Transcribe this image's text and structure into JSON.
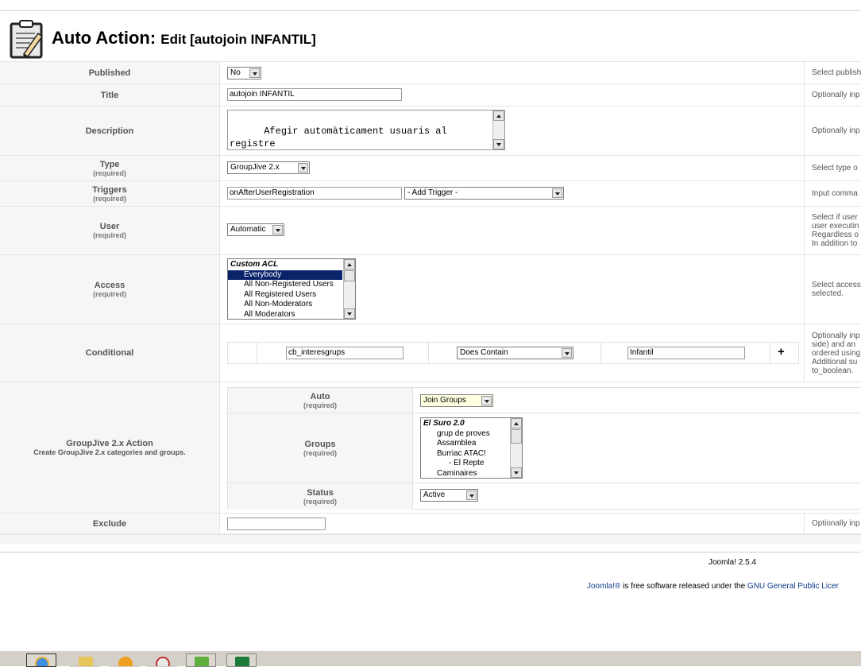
{
  "header": {
    "title_main": "Auto Action:",
    "title_sub": "Edit [autojoin INFANTIL]",
    "icon": "clipboard-pencil-icon"
  },
  "required_text": "(required)",
  "rows": {
    "published": {
      "label": "Published",
      "value": "No",
      "help": "Select publish"
    },
    "title": {
      "label": "Title",
      "value": "autojoin INFANTIL",
      "help": "Optionally inp"
    },
    "description": {
      "label": "Description",
      "value": "Afegir automàticament usuaris al registre",
      "help": "Optionally inp"
    },
    "type": {
      "label": "Type",
      "value": "GroupJive 2.x",
      "help": "Select type o"
    },
    "triggers": {
      "label": "Triggers",
      "value": "onAfterUserRegistration",
      "add_trigger": "- Add Trigger -",
      "help": "Input comma"
    },
    "user": {
      "label": "User",
      "value": "Automatic",
      "help_lines": [
        "Select if user",
        "user executin",
        "Regardless o",
        "In addition to"
      ]
    },
    "access": {
      "label": "Access",
      "options": [
        {
          "text": "Custom ACL",
          "group": true,
          "selected": false
        },
        {
          "text": "Everybody",
          "group": false,
          "selected": true
        },
        {
          "text": "All Non-Registered Users",
          "group": false,
          "selected": false
        },
        {
          "text": "All Registered Users",
          "group": false,
          "selected": false
        },
        {
          "text": "All Non-Moderators",
          "group": false,
          "selected": false
        },
        {
          "text": "All Moderators",
          "group": false,
          "selected": false
        }
      ],
      "help_lines": [
        "Select access",
        "selected."
      ]
    },
    "conditional": {
      "label": "Conditional",
      "field": "cb_interesgrups",
      "operator": "Does Contain",
      "value": "Infantil",
      "add_symbol": "+",
      "help_lines": [
        "Optionally inp",
        "side) and an",
        "ordered using",
        "Additional su",
        "to_boolean."
      ]
    },
    "groupjive": {
      "label": "GroupJive 2.x Action",
      "desc": "Create GroupJive 2.x categories and groups.",
      "auto": {
        "label": "Auto",
        "value": "Join Groups"
      },
      "groups": {
        "label": "Groups",
        "options": [
          {
            "text": "El Suro 2.0",
            "level": 0
          },
          {
            "text": "grup de proves",
            "level": 1
          },
          {
            "text": "Assamblea",
            "level": 1
          },
          {
            "text": "Burriac ATAC!",
            "level": 1
          },
          {
            "text": "- El Repte",
            "level": 2
          },
          {
            "text": "Caminaires",
            "level": 1
          }
        ]
      },
      "status": {
        "label": "Status",
        "value": "Active"
      }
    },
    "exclude": {
      "label": "Exclude",
      "value": "",
      "help": "Optionally inp"
    }
  },
  "footer": {
    "version": "Joomla! 2.5.4",
    "license_brand": "Joomla!®",
    "license_text": " is free software released under the ",
    "license_link": "GNU General Public Licer"
  },
  "colors": {
    "accent": "#0a246a",
    "auto_bg": "#ffffe1",
    "link": "#0b3b8c"
  }
}
